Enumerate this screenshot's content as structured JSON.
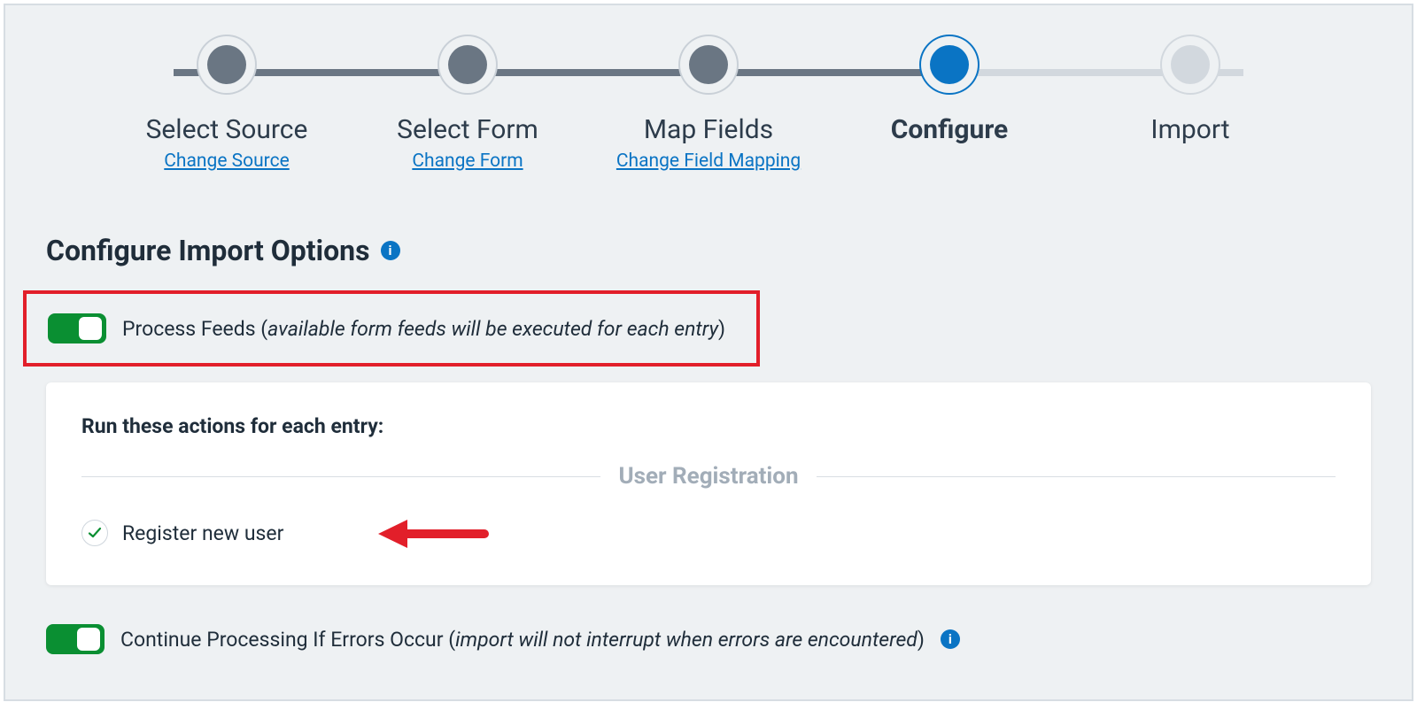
{
  "stepper": {
    "steps": [
      {
        "title": "Select Source",
        "link": "Change Source",
        "state": "done"
      },
      {
        "title": "Select Form",
        "link": "Change Form",
        "state": "done"
      },
      {
        "title": "Map Fields",
        "link": "Change Field Mapping",
        "state": "done"
      },
      {
        "title": "Configure",
        "link": null,
        "state": "current"
      },
      {
        "title": "Import",
        "link": null,
        "state": "future"
      }
    ]
  },
  "heading": "Configure Import Options",
  "process_feeds": {
    "enabled": true,
    "label_prefix": "Process Feeds (",
    "label_italic": "available form feeds will be executed for each entry",
    "label_suffix": ")"
  },
  "panel": {
    "title": "Run these actions for each entry:",
    "group_label": "User Registration",
    "actions": [
      {
        "label": "Register new user",
        "checked": true
      }
    ]
  },
  "continue_on_error": {
    "enabled": true,
    "label_prefix": "Continue Processing If Errors Occur (",
    "label_italic": "import will not interrupt when errors are encountered",
    "label_suffix": ")"
  },
  "colors": {
    "accent": "#0a74c4",
    "done": "#6a7683",
    "future": "#d2d8de",
    "toggle_on": "#0a8f32",
    "highlight": "#e21f2a"
  }
}
